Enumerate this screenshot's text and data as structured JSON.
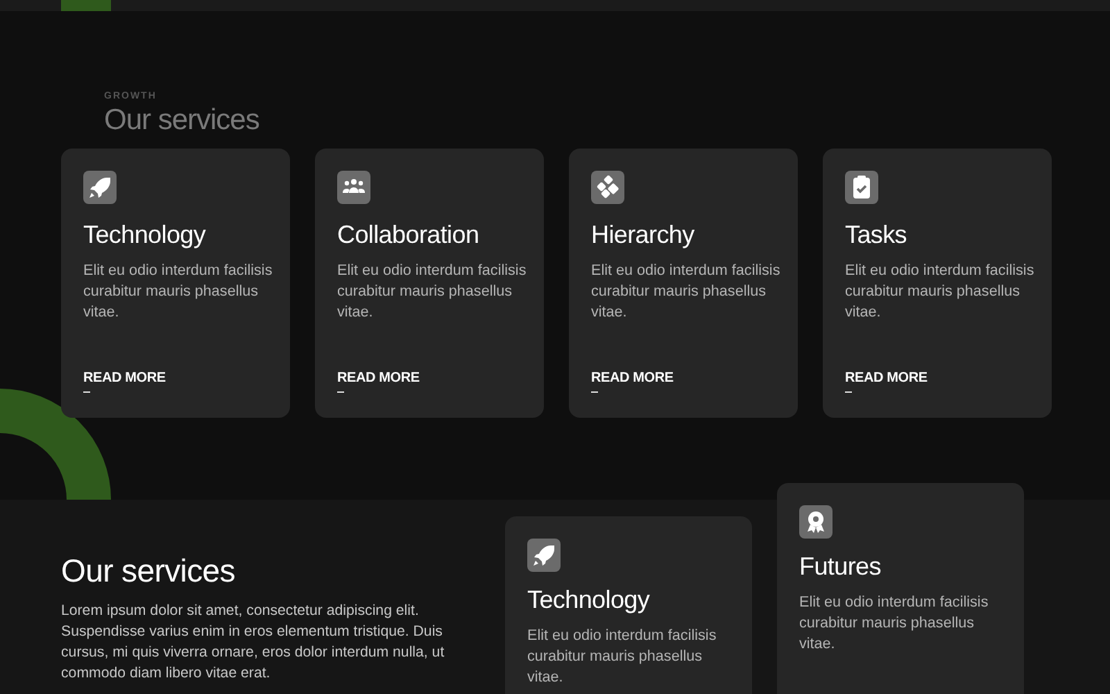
{
  "services_section": {
    "eyebrow": "GROWTH",
    "heading": "Our services",
    "cards": [
      {
        "title": "Technology",
        "description": "Elit eu odio interdum facilisis curabitur mauris phasellus vitae.",
        "link": "READ MORE"
      },
      {
        "title": "Collaboration",
        "description": "Elit eu odio interdum facilisis curabitur mauris phasellus vitae.",
        "link": "READ MORE"
      },
      {
        "title": "Hierarchy",
        "description": "Elit eu odio interdum facilisis curabitur mauris phasellus vitae.",
        "link": "READ MORE"
      },
      {
        "title": "Tasks",
        "description": "Elit eu odio interdum facilisis curabitur mauris phasellus vitae.",
        "link": "READ MORE"
      }
    ]
  },
  "intro_section": {
    "heading": "Our services",
    "paragraph": "Lorem ipsum dolor sit amet, consectetur adipiscing elit. Suspendisse varius enim in eros elementum tristique. Duis cursus, mi quis viverra ornare, eros dolor interdum nulla, ut commodo diam libero vitae erat.",
    "cards": [
      {
        "title": "Technology",
        "description": "Elit eu odio interdum facilisis curabitur mauris phasellus vitae."
      },
      {
        "title": "Futures",
        "description": "Elit eu odio interdum facilisis curabitur mauris phasellus vitae."
      }
    ]
  }
}
